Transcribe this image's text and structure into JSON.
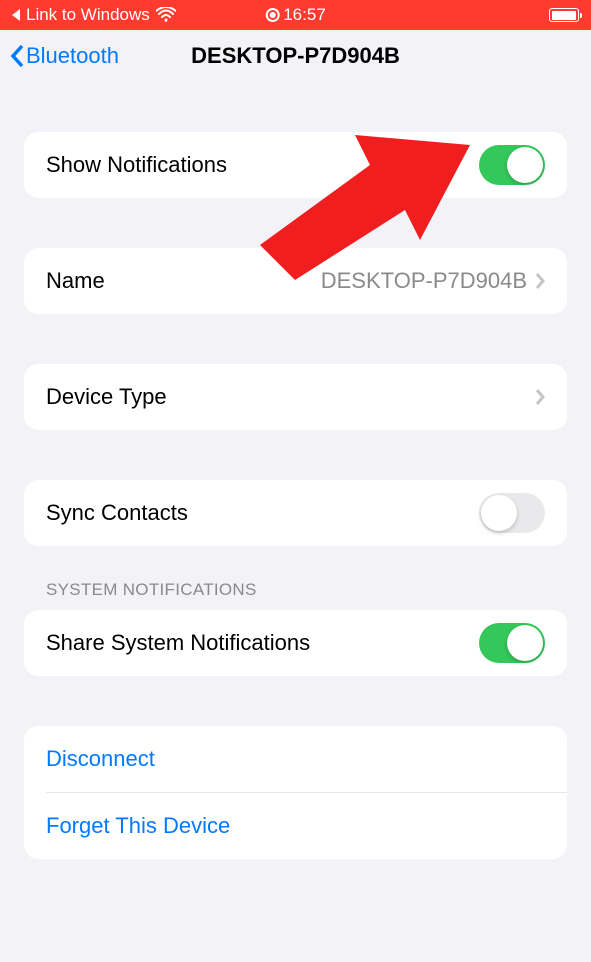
{
  "status_bar": {
    "back_app": "Link to Windows",
    "time": "16:57"
  },
  "nav": {
    "back_label": "Bluetooth",
    "title": "DESKTOP-P7D904B"
  },
  "rows": {
    "show_notifications": {
      "label": "Show Notifications",
      "on": true
    },
    "name": {
      "label": "Name",
      "value": "DESKTOP-P7D904B"
    },
    "device_type": {
      "label": "Device Type"
    },
    "sync_contacts": {
      "label": "Sync Contacts",
      "on": false
    },
    "system_notifications_header": "SYSTEM NOTIFICATIONS",
    "share_system_notifications": {
      "label": "Share System Notifications",
      "on": true
    }
  },
  "actions": {
    "disconnect": "Disconnect",
    "forget": "Forget This Device"
  }
}
